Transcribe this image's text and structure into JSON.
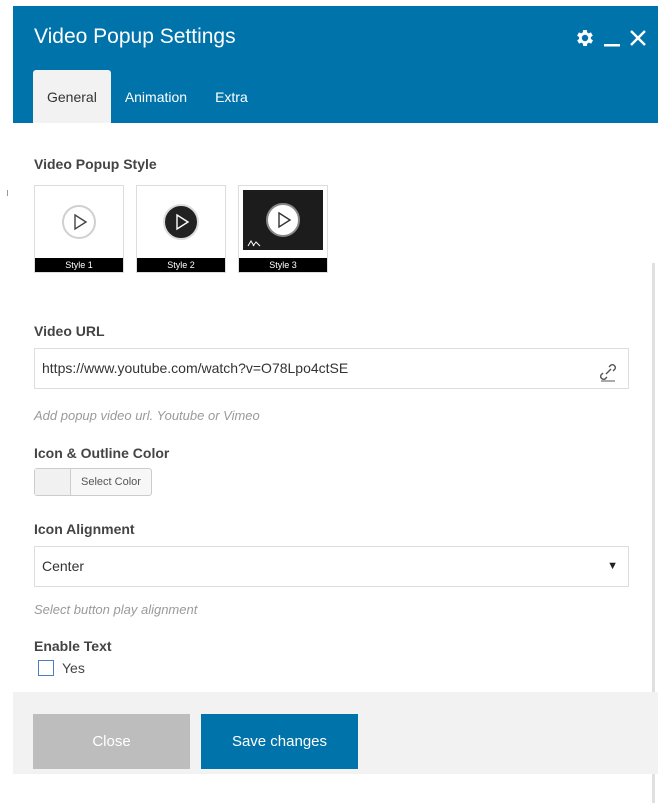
{
  "dialog": {
    "title": "Video Popup Settings",
    "icons": [
      "gear-icon",
      "minimize-icon",
      "close-icon"
    ]
  },
  "tabs": [
    {
      "label": "General",
      "active": true
    },
    {
      "label": "Animation",
      "active": false
    },
    {
      "label": "Extra",
      "active": false
    }
  ],
  "video_popup_style": {
    "label": "Video Popup Style",
    "options": [
      "Style 1",
      "Style 2",
      "Style 3"
    ]
  },
  "video_url": {
    "label": "Video URL",
    "value": "https://www.youtube.com/watch?v=O78Lpo4ctSE",
    "hint": "Add popup video url. Youtube or Vimeo"
  },
  "icon_color": {
    "label": "Icon & Outline Color",
    "button_label": "Select Color"
  },
  "icon_alignment": {
    "label": "Icon Alignment",
    "value": "Center",
    "hint": "Select button play alignment"
  },
  "enable_text": {
    "label": "Enable Text",
    "option": "Yes",
    "checked": false
  },
  "footer": {
    "close_label": "Close",
    "save_label": "Save changes"
  },
  "colors": {
    "header": "#0073aa",
    "save_button": "#0073aa",
    "close_button": "#bdbdbd",
    "panel_bg": "#f2f2f2"
  }
}
